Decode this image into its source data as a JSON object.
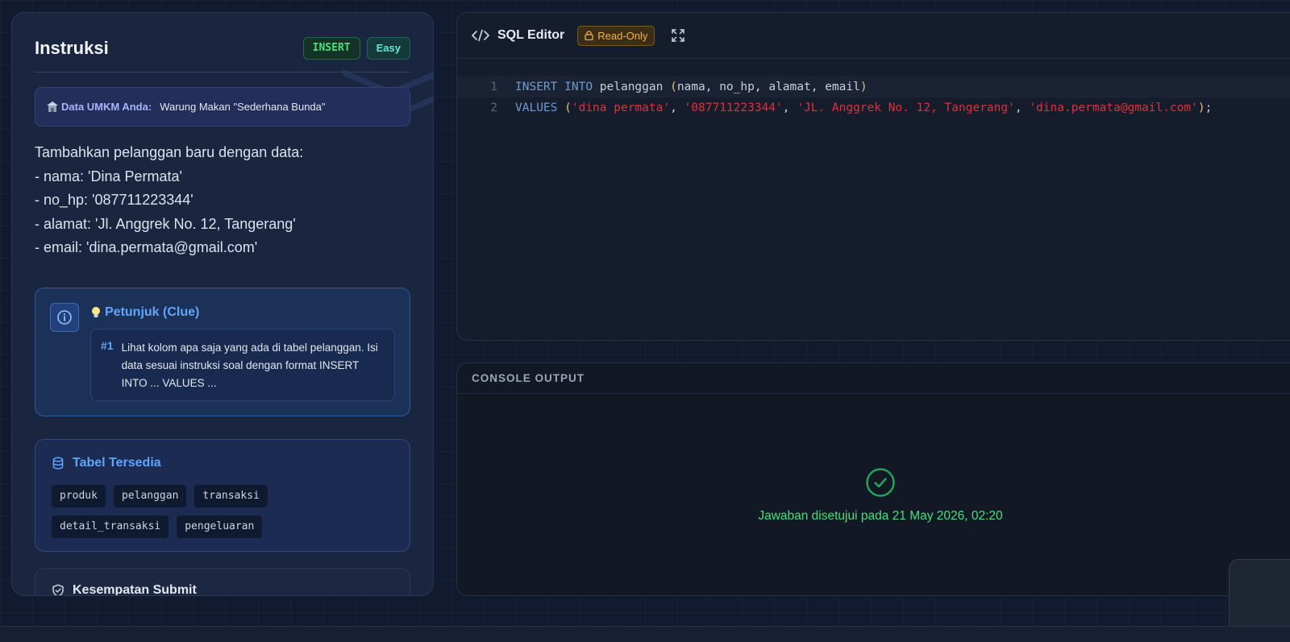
{
  "instructions": {
    "title": "Instruksi",
    "badge_type": "INSERT",
    "badge_level": "Easy",
    "umkm_label": "Data UMKM Anda:",
    "umkm_value": "Warung Makan \"Sederhana Bunda\"",
    "description_lines": [
      "Tambahkan pelanggan baru dengan data:",
      "- nama: 'Dina Permata'",
      "- no_hp: '087711223344'",
      "- alamat: 'Jl. Anggrek No. 12, Tangerang'",
      "- email: 'dina.permata@gmail.com'"
    ]
  },
  "clue": {
    "title": "Petunjuk (Clue)",
    "items": [
      {
        "number": "#1",
        "text": "Lihat kolom apa saja yang ada di tabel pelanggan. Isi data sesuai instruksi soal dengan format INSERT INTO ... VALUES ..."
      }
    ]
  },
  "tables": {
    "title": "Tabel Tersedia",
    "items": [
      "produk",
      "pelanggan",
      "transaksi",
      "detail_transaksi",
      "pengeluaran"
    ]
  },
  "submit": {
    "title": "Kesempatan Submit"
  },
  "editor": {
    "title": "SQL Editor",
    "readonly_label": "Read-Only",
    "lines": [
      {
        "number": "1"
      },
      {
        "number": "2"
      }
    ],
    "tokens": {
      "insert_kw": "INSERT",
      "into_kw": "INTO",
      "table": "pelanggan",
      "columns": "nama, no_hp, alamat, email",
      "values_kw": "VALUES",
      "v1": "'dina permata'",
      "v2": "'087711223344'",
      "v3": "'JL. Anggrek No. 12, Tangerang'",
      "v4": "'dina.permata@gmail.com'"
    }
  },
  "console": {
    "title": "CONSOLE OUTPUT",
    "message": "Jawaban disetujui pada 21 May 2026, 02:20"
  },
  "colors": {
    "accent_blue": "#60a5fa",
    "success_green": "#4ade80",
    "warning_amber": "#f5b14a",
    "sql_string_red": "#e0313a"
  }
}
